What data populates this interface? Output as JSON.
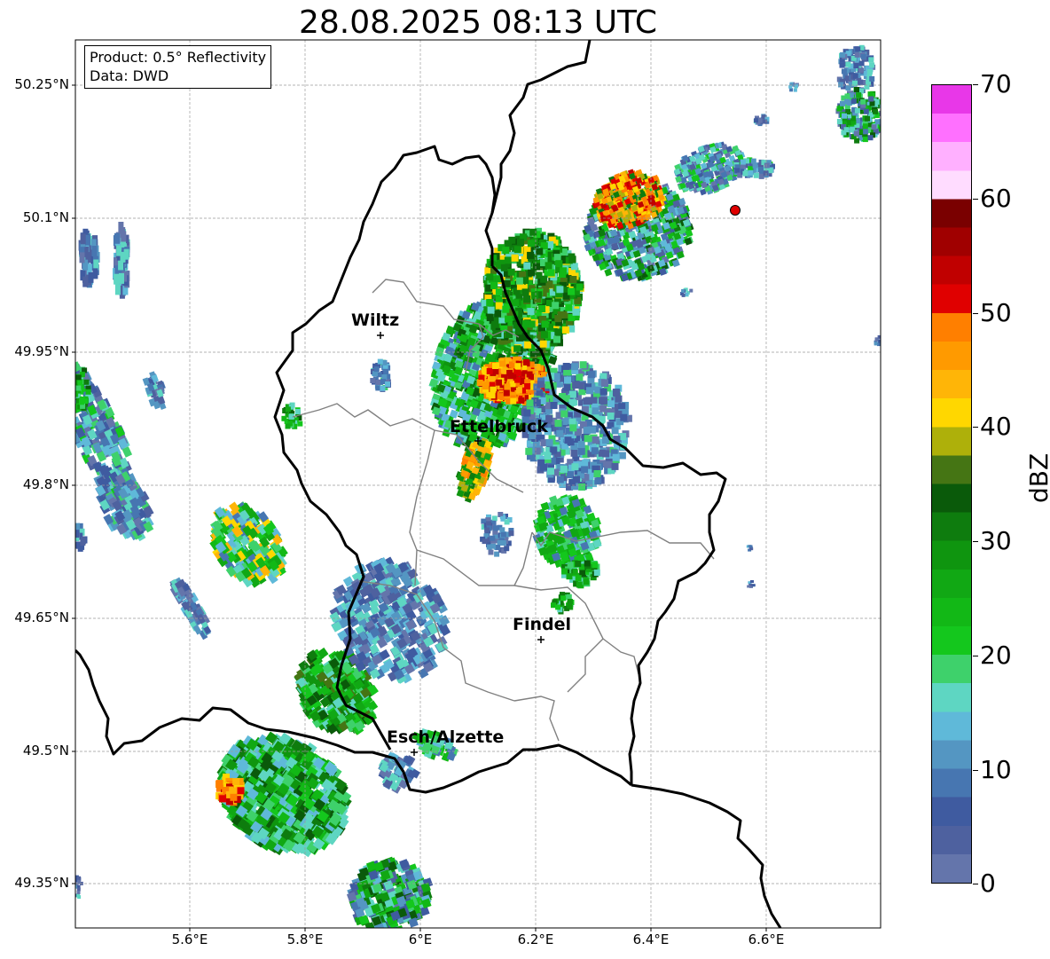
{
  "title": "28.08.2025 08:13 UTC",
  "info": {
    "product": "Product: 0.5° Reflectivity",
    "data": "Data: DWD"
  },
  "axes": {
    "y_labels": [
      "50.25°N",
      "50.1°N",
      "49.95°N",
      "49.8°N",
      "49.65°N",
      "49.5°N",
      "49.35°N"
    ],
    "x_labels": [
      "5.6°E",
      "5.8°E",
      "6°E",
      "6.2°E",
      "6.4°E",
      "6.6°E"
    ]
  },
  "colorbar": {
    "title": "dBZ",
    "tick_labels": [
      "0",
      "10",
      "20",
      "30",
      "40",
      "50",
      "60",
      "70"
    ],
    "colors": [
      "#6475ab",
      "#4e619f",
      "#3f5ba0",
      "#4776b1",
      "#5496c2",
      "#5fb9d9",
      "#5ed6c2",
      "#3ed16b",
      "#14c71d",
      "#12b816",
      "#11a814",
      "#0f950f",
      "#0e7c0e",
      "#0a5a0a",
      "#457514",
      "#aeb00a",
      "#ffd700",
      "#ffb507",
      "#ff9a00",
      "#ff7f00",
      "#e00000",
      "#c00000",
      "#a00000",
      "#7a0000",
      "#ffdcff",
      "#ffb0ff",
      "#ff70ff",
      "#e837e8"
    ]
  },
  "cities": [
    {
      "name": "Wiltz"
    },
    {
      "name": "Ettelbruck"
    },
    {
      "name": "Findel"
    },
    {
      "name": "Esch/Alzette"
    }
  ],
  "marker": {
    "color": "#e00000",
    "shape": "circle"
  }
}
